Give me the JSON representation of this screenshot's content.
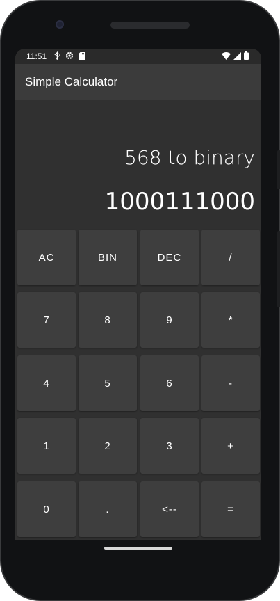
{
  "status_bar": {
    "time": "11:51",
    "left_icons": [
      "usb-icon",
      "settings-icon",
      "sd-card-icon"
    ],
    "right_icons": [
      "wifi-icon",
      "signal-icon",
      "battery-icon"
    ]
  },
  "app_bar": {
    "title": "Simple Calculator"
  },
  "display": {
    "expression": "568 to binary",
    "result": "1000111000"
  },
  "keypad": {
    "rows": [
      [
        "AC",
        "BIN",
        "DEC",
        "/"
      ],
      [
        "7",
        "8",
        "9",
        "*"
      ],
      [
        "4",
        "5",
        "6",
        "-"
      ],
      [
        "1",
        "2",
        "3",
        "+"
      ],
      [
        "0",
        ".",
        "<--",
        "="
      ]
    ]
  },
  "colors": {
    "screen_background": "#303030",
    "app_bar": "#3b3b3b",
    "key_background": "#3e3e3e",
    "text": "#ffffff"
  }
}
